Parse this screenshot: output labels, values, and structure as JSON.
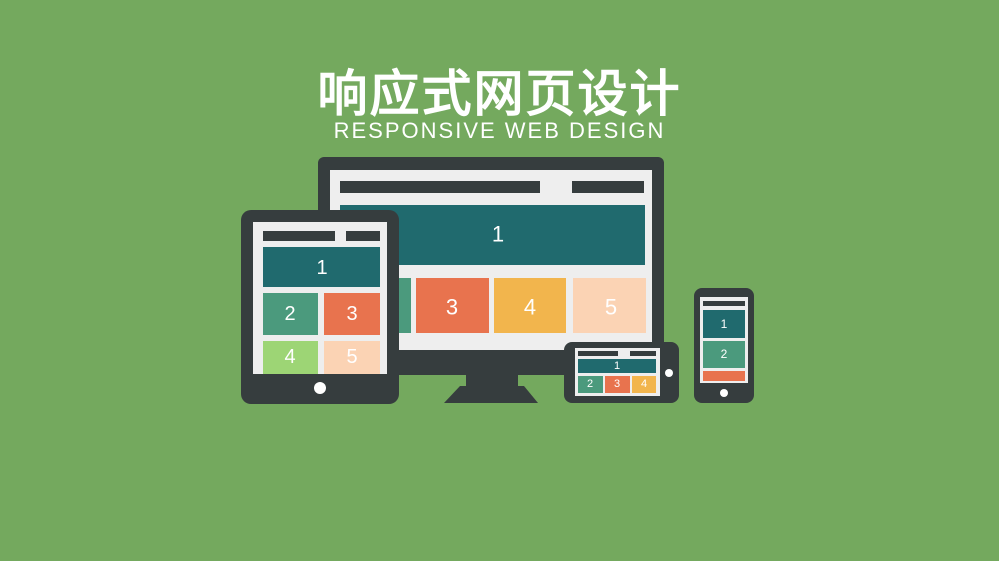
{
  "title": {
    "chinese": "响应式网页设计",
    "english": "RESPONSIVE WEB DESIGN"
  },
  "desktop": {
    "blocks": [
      "1",
      "3",
      "4",
      "5"
    ]
  },
  "tablet": {
    "blocks": [
      "1",
      "2",
      "3",
      "4",
      "5"
    ]
  },
  "phone_landscape": {
    "blocks": [
      "1",
      "2",
      "3",
      "4"
    ]
  },
  "phone_portrait": {
    "blocks": [
      "1",
      "2"
    ]
  },
  "colors": {
    "background": "#74a95e",
    "device": "#363d3e",
    "teal": "#206a6e",
    "green": "#4b9a7d",
    "orange": "#e8734e",
    "yellow": "#f2b54d",
    "peach": "#fbd3b4",
    "light_green": "#9dd575"
  }
}
